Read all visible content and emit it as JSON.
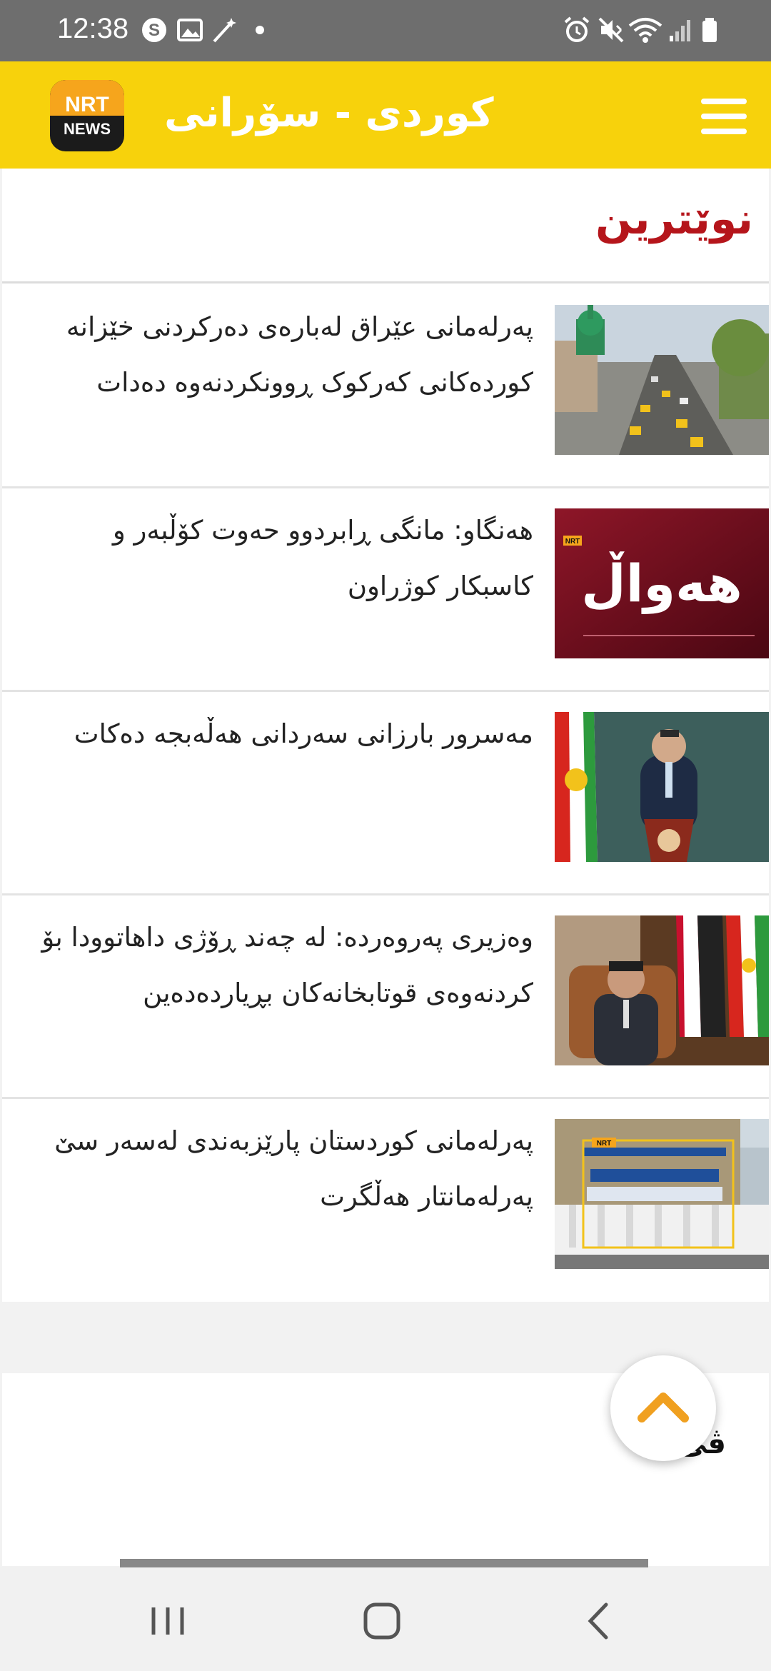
{
  "status_bar": {
    "time": "12:38",
    "icons_left": [
      "skype-icon",
      "gallery-icon",
      "magic-wand-icon",
      "dot-icon"
    ],
    "icons_right": [
      "alarm-icon",
      "mute-icon",
      "wifi-icon",
      "signal-icon",
      "battery-icon"
    ]
  },
  "header": {
    "logo_top": "NRT",
    "logo_bottom": "NEWS",
    "title": "کوردی - سۆرانی",
    "menu_icon": "hamburger-menu-icon"
  },
  "latest": {
    "heading": "نوێترین",
    "items": [
      {
        "title": "پەرلەمانی عێراق لەبارەی دەرکردنی خێزانە کوردەکانی کەرکوک ڕوونکردنەوە دەدات",
        "thumb": "city-street-photo"
      },
      {
        "title": "هەنگاو: مانگی ڕابردوو حەوت کۆڵبەر و کاسبکار کوژراون",
        "thumb": "news-graphic",
        "thumb_text": "هەواڵ",
        "thumb_badge": "NRT"
      },
      {
        "title": "مەسرور بارزانی سەردانی هەڵەبجە دەکات",
        "thumb": "podium-speaker-photo"
      },
      {
        "title": "وەزیری پەروەردە: لە چەند ڕۆژی داهاتوودا بۆ کردنەوەی قوتابخانەکان بڕیاردەدەین",
        "thumb": "minister-office-photo"
      },
      {
        "title": "پەرلەمانی کوردستان پارێزبەندی لەسەر سێ پەرلەمانتار هەڵگرت",
        "thumb": "parliament-building-photo",
        "thumb_badge": "NRT"
      }
    ]
  },
  "video_section": {
    "heading_fragment": "ڤی"
  },
  "scroll_top": {
    "icon": "chevron-up-icon"
  },
  "colors": {
    "header_bg": "#f7d20c",
    "heading_red": "#b5151b",
    "accent_orange": "#f0a020",
    "status_bg": "#6e6e6e"
  }
}
